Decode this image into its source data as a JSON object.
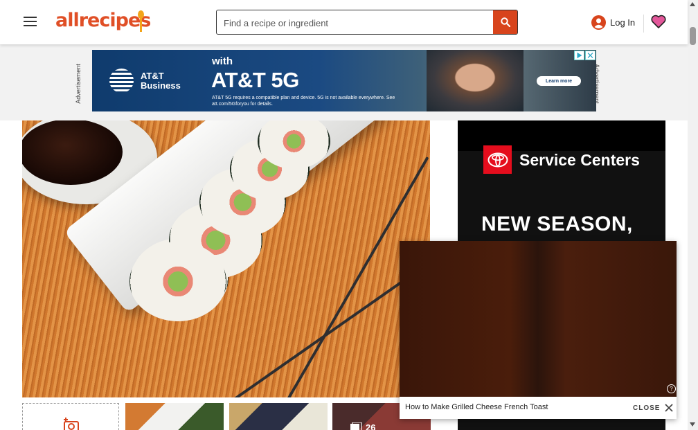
{
  "header": {
    "logo_text": "allrecipes",
    "search_placeholder": "Find a recipe or ingredient",
    "login_label": "Log In",
    "brand_color": "#e04f26",
    "search_button_color": "#d8441c"
  },
  "top_ad": {
    "side_label": "Advertisement",
    "brand_line1": "AT&T",
    "brand_line2": "Business",
    "with_text": "with",
    "headline": "AT&T 5G",
    "fine_print": "AT&T 5G requires a compatible plan and device. 5G is not available everywhere. See att.com/5Gforyou for details.",
    "cta": "Learn more"
  },
  "gallery": {
    "photo_count": "26"
  },
  "side_ad": {
    "title": "Service Centers",
    "tagline": "NEW SEASON,"
  },
  "video": {
    "title": "How to Make Grilled Cheese French Toast",
    "close_label": "CLOSE",
    "help_icon": "?"
  }
}
